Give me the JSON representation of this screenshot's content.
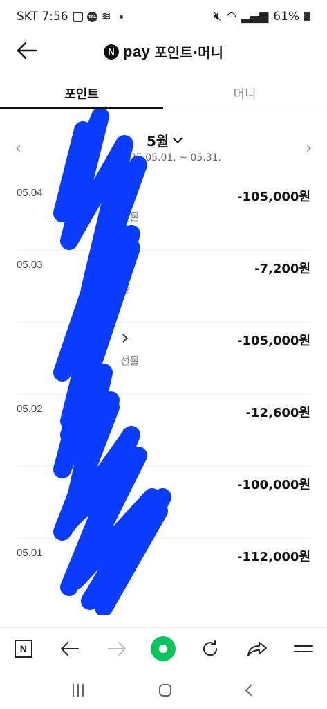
{
  "status_bar": {
    "carrier_time": "SKT 7:56",
    "talk_badge": "TALK",
    "battery": "61%"
  },
  "header": {
    "n_logo": "N",
    "pay_word": "pay",
    "title": "포인트·머니"
  },
  "tabs": [
    {
      "label": "포인트",
      "active": true
    },
    {
      "label": "머니",
      "active": false
    }
  ],
  "month": {
    "label": "5월",
    "range": "25.05.01. ~ 05.31."
  },
  "transactions": [
    {
      "date": "05.04",
      "amount": "-105,000원",
      "sub": "선물"
    },
    {
      "date": "05.03",
      "amount": "-7,200원",
      "sub": "물"
    },
    {
      "date": "",
      "amount": "-105,000원",
      "sub": "선물"
    },
    {
      "date": "05.02",
      "amount": "-12,600원",
      "sub": "선물"
    },
    {
      "date": "",
      "amount": "-100,000원",
      "sub": ""
    },
    {
      "date": "05.01",
      "amount": "-112,000원",
      "sub": "물"
    }
  ],
  "toolbar": {
    "n_label": "N"
  },
  "colors": {
    "accent_green": "#03c75a",
    "scribble_blue": "#0a3cff"
  }
}
